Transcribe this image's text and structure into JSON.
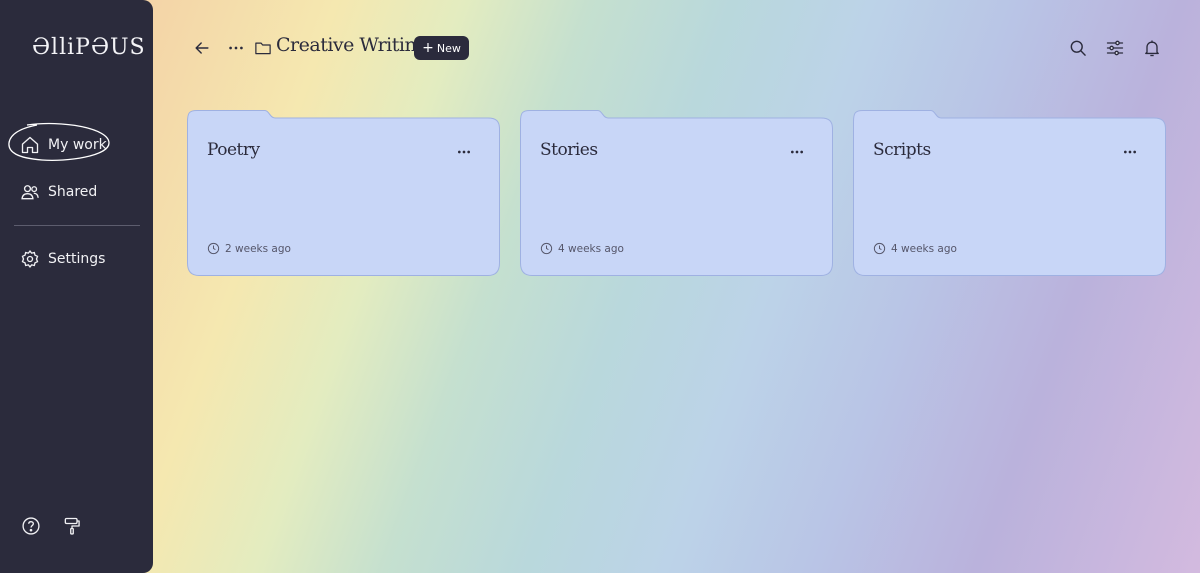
{
  "app": {
    "logo_text": "ƏlliPƏUS"
  },
  "sidebar": {
    "items": [
      {
        "label": "My work",
        "icon": "home-icon"
      },
      {
        "label": "Shared",
        "icon": "users-icon"
      },
      {
        "label": "Settings",
        "icon": "gear-icon"
      }
    ],
    "bottom_icons": [
      "help-icon",
      "paint-roller-icon"
    ]
  },
  "header": {
    "folder_title": "Creative Writing",
    "new_button_label": "New",
    "right_icons": [
      "search-icon",
      "filter-sliders-icon",
      "bell-icon"
    ]
  },
  "folders": [
    {
      "title": "Poetry",
      "updated": "2 weeks ago"
    },
    {
      "title": "Stories",
      "updated": "4 weeks ago"
    },
    {
      "title": "Scripts",
      "updated": "4 weeks ago"
    }
  ],
  "colors": {
    "sidebar_bg": "#2b2b3c",
    "card_bg": "#c8d6f7",
    "card_border": "#9fb1e2",
    "text_dark": "#2b2b3c"
  }
}
